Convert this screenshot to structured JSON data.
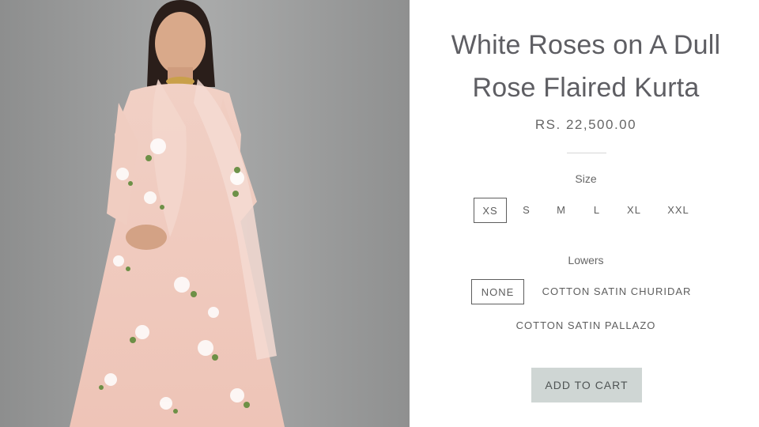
{
  "product": {
    "image_alt": "Model wearing a pale pink floral anarkali kurta with dupatta",
    "title_line1": "White Roses on A Dull",
    "title_line2": "Rose Flaired Kurta",
    "price": "RS. 22,500.00"
  },
  "size": {
    "label": "Size",
    "options": [
      "XS",
      "S",
      "M",
      "L",
      "XL",
      "XXL"
    ],
    "selected": "XS"
  },
  "lowers": {
    "label": "Lowers",
    "options": [
      "NONE",
      "COTTON SATIN CHURIDAR",
      "COTTON SATIN PALLAZO"
    ],
    "selected": "NONE"
  },
  "cart": {
    "label": "ADD TO CART"
  },
  "colors": {
    "background_photo": "#9a9b9b",
    "kurta": "#f2cfc3",
    "button": "#cfd6d4",
    "text": "#5e5e63"
  }
}
